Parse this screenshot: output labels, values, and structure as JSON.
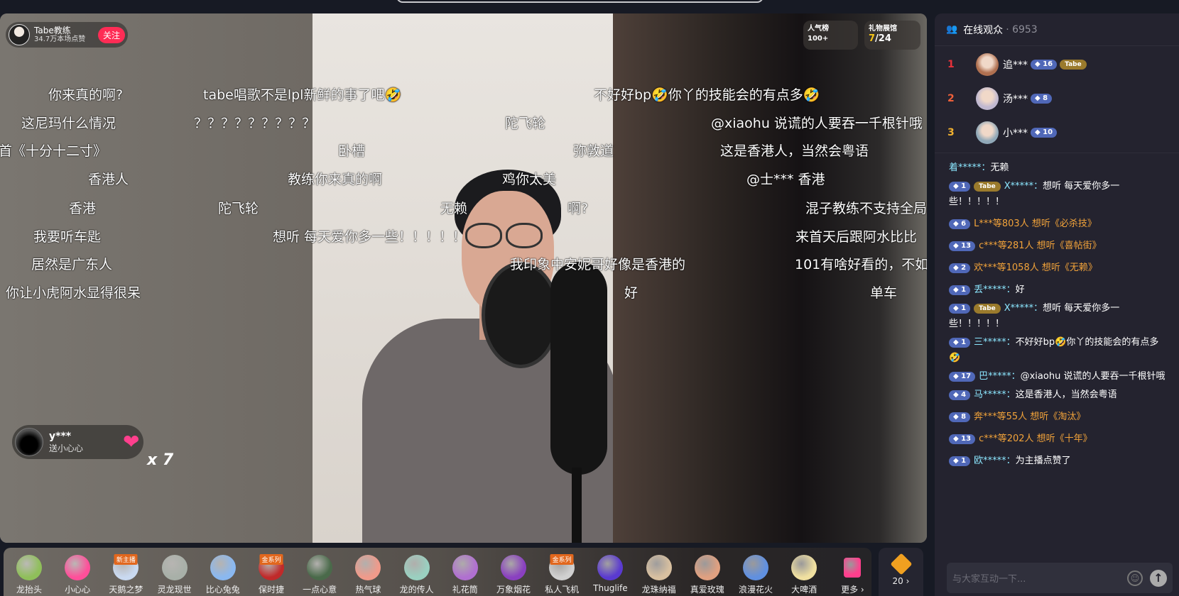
{
  "streamer": {
    "name": "Tabe教练",
    "likes": "34.7万本场点赞",
    "follow_label": "关注"
  },
  "rank_cards": [
    {
      "title": "人气榜",
      "value": "100+"
    },
    {
      "title": "礼物展馆",
      "value_current": "7",
      "value_total": "/24"
    }
  ],
  "danmaku": [
    [
      "你来真的啊?",
      "tabe唱歌不是lpl新鲜的事了吧🤣",
      "不好好bp🤣你丫的技能会的有点多🤣"
    ],
    [
      "这尼玛什么情况",
      "？？？？？？？？？",
      "陀飞轮",
      "@xiaohu 说谎的人要吞一千根针哦"
    ],
    [
      "首《十分十二寸》",
      "卧槽",
      "弥敦道",
      "这是香港人，当然会粤语"
    ],
    [
      "香港人",
      "教练你来真的啊",
      "鸡你太美",
      "@士*** 香港"
    ],
    [
      "香港",
      "陀飞轮",
      "无赖",
      "啊?",
      "混子教练不支持全局"
    ],
    [
      "我要听车匙",
      "想听 每天爱你多一些！！！！！",
      "来首天后跟阿水比比"
    ],
    [
      "居然是广东人",
      "我印象中安妮哥好像是香港的",
      "101有啥好看的，不如"
    ],
    [
      "你让小虎阿水显得很呆",
      "好",
      "单车"
    ]
  ],
  "gift_notice": {
    "user": "y***",
    "action": "送小心心",
    "count": "x 7"
  },
  "gifts": [
    {
      "label": "龙抬头",
      "color": "#8fbf5a"
    },
    {
      "label": "小心心",
      "color": "#ff4f9a"
    },
    {
      "label": "天鹅之梦",
      "badge": "新主播",
      "color": "#c9d9f0"
    },
    {
      "label": "灵龙现世",
      "color": "#a8b0a8"
    },
    {
      "label": "比心兔兔",
      "color": "#8ab8f0"
    },
    {
      "label": "保时捷",
      "badge": "金系列",
      "color": "#c02a2a"
    },
    {
      "label": "一点心意",
      "color": "#4a6a4a"
    },
    {
      "label": "热气球",
      "color": "#f09a8a"
    },
    {
      "label": "龙的传人",
      "color": "#9ad0c0"
    },
    {
      "label": "礼花筒",
      "color": "#b070d0"
    },
    {
      "label": "万象烟花",
      "color": "#8a40c0"
    },
    {
      "label": "私人飞机",
      "badge": "金系列",
      "color": "#d0d0d0"
    },
    {
      "label": "Thuglife",
      "color": "#5a3ad0"
    },
    {
      "label": "龙珠纳福",
      "color": "#d8c0a0"
    },
    {
      "label": "真爱玫瑰",
      "color": "#e0a080"
    },
    {
      "label": "浪漫花火",
      "color": "#6090e0"
    },
    {
      "label": "大啤酒",
      "color": "#f0e0a0"
    },
    {
      "label": "更多 ›",
      "color": "#ff3f8d"
    }
  ],
  "coins": {
    "label": "20 ›",
    "color": "#f0a020"
  },
  "sidebar": {
    "title": "在线观众",
    "count": "· 6953",
    "ranks": [
      {
        "rank": "1",
        "name": "追***",
        "level": "16",
        "fan": "Tabe",
        "rank_color": "#e8313a",
        "avatar": "#b07050"
      },
      {
        "rank": "2",
        "name": "汤***",
        "level": "8",
        "rank_color": "#f0603a",
        "avatar": "#c0b8d0"
      },
      {
        "rank": "3",
        "name": "小***",
        "level": "10",
        "rank_color": "#f0b030",
        "avatar": "#90a8b8"
      }
    ],
    "messages": [
      {
        "user": "着*****：",
        "text": "无赖"
      },
      {
        "level": "1",
        "fan": "Tabe",
        "user": "X*****：",
        "text": "想听 每天爱你多一些！！！！！"
      },
      {
        "level": "6",
        "sys": "L***等803人 想听《必杀技》"
      },
      {
        "level": "13",
        "sys": "c***等281人 想听《喜帖街》"
      },
      {
        "level": "2",
        "sys": "欢***等1058人 想听《无赖》"
      },
      {
        "level": "1",
        "user": "丢*****：",
        "text": "好"
      },
      {
        "level": "1",
        "fan": "Tabe",
        "user": "X*****：",
        "text": "想听 每天爱你多一些！！！！！"
      },
      {
        "level": "1",
        "user": "三*****：",
        "text": "不好好bp🤣你丫的技能会的有点多🤣"
      },
      {
        "level": "17",
        "user": "巴*****：",
        "text": "@xiaohu 说谎的人要吞一千根针哦"
      },
      {
        "level": "4",
        "user": "马*****：",
        "text": "这是香港人，当然会粤语"
      },
      {
        "level": "8",
        "sys": "奔***等55人 想听《淘汰》"
      },
      {
        "level": "13",
        "sys": "c***等202人 想听《十年》"
      },
      {
        "level": "1",
        "user": "欧*****：",
        "text": "为主播点赞了"
      }
    ],
    "input_placeholder": "与大家互动一下..."
  }
}
